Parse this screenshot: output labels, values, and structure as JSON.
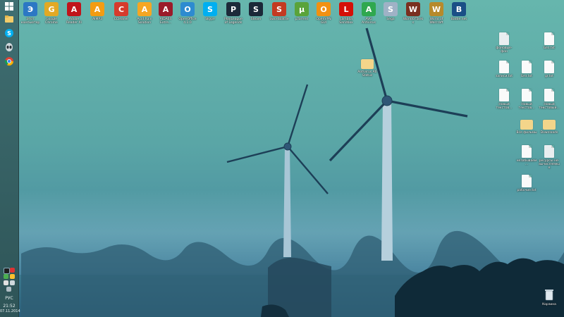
{
  "taskbar": {
    "pinned": [
      {
        "name": "start-button",
        "icon": "windows-logo-icon"
      },
      {
        "name": "explorer",
        "icon": "folder-icon"
      },
      {
        "name": "skype",
        "icon": "skype-icon"
      },
      {
        "name": "alienware",
        "icon": "alien-icon"
      },
      {
        "name": "chrome",
        "icon": "chrome-icon"
      }
    ],
    "language": "РУС",
    "time": "21:52",
    "date": "07.11.2014"
  },
  "desktop_top_row": [
    {
      "label": "Этот компьютер",
      "icon": "computer-icon",
      "color": "#2c78c4"
    },
    {
      "label": "Google Chrome",
      "icon": "chrome-icon",
      "color": "#e2a925"
    },
    {
      "label": "Adobe Reader XI",
      "icon": "acrobat-icon",
      "color": "#c0141b"
    },
    {
      "label": "AIMP3",
      "icon": "aimp-icon",
      "color": "#f39c12"
    },
    {
      "label": "CCleaner",
      "icon": "ccleaner-icon",
      "color": "#d63b2c"
    },
    {
      "label": "Acid Rain Solution",
      "icon": "star-icon",
      "color": "#f5a623"
    },
    {
      "label": "AIDA64 Extre...",
      "icon": "aida64-icon",
      "color": "#9b1b2a"
    },
    {
      "label": "OpenOffice 4.1.0",
      "icon": "openoffice-icon",
      "color": "#2d8bd0"
    },
    {
      "label": "Skype",
      "icon": "skype-icon",
      "color": "#00aff0"
    },
    {
      "label": "PlayLeague of Legends",
      "icon": "lol-icon",
      "color": "#1c2a3a"
    },
    {
      "label": "Steam",
      "icon": "steam-icon",
      "color": "#1b2838"
    },
    {
      "label": "SwordBattle",
      "icon": "game-icon",
      "color": "#c33a22"
    },
    {
      "label": "µTorrent",
      "icon": "utorrent-icon",
      "color": "#5aa33a"
    },
    {
      "label": "OpenVPN GUI",
      "icon": "openvpn-icon",
      "color": "#f29111"
    },
    {
      "label": "Lambda Sandbox",
      "icon": "lastfm-icon",
      "color": "#d51007"
    },
    {
      "label": "AVG Antivirus",
      "icon": "avg-icon",
      "color": "#2fa84f"
    },
    {
      "label": "Sega",
      "icon": "sega-icon",
      "color": "#9fb2c6"
    },
    {
      "label": "WorldOfTanks",
      "icon": "tanks-icon",
      "color": "#7a2f1f"
    },
    {
      "label": "World of Warcraft",
      "icon": "wow-icon",
      "color": "#b68a2c"
    },
    {
      "label": "Battle.net",
      "icon": "battlenet-icon",
      "color": "#1a4f86"
    }
  ],
  "desktop_mid": {
    "label": "Antivirus Ati Status",
    "icon": "folder-icon"
  },
  "desktop_right": [
    {
      "label": "фоновые-фон",
      "icon": "image-file-icon",
      "kind": "image"
    },
    {
      "label": "Без.txt",
      "icon": "text-file-icon",
      "kind": "file"
    },
    {
      "label": "записи.txt",
      "icon": "text-file-icon",
      "kind": "file"
    },
    {
      "label": "Без.txt",
      "icon": "text-file-icon",
      "kind": "file"
    },
    {
      "label": "gr.txt",
      "icon": "text-file-icon",
      "kind": "file"
    },
    {
      "label": "Новый текстов...",
      "icon": "text-file-icon",
      "kind": "file"
    },
    {
      "label": "Новый текстов...",
      "icon": "text-file-icon",
      "kind": "file"
    },
    {
      "label": "Новый текстовый...",
      "icon": "text-file-icon",
      "kind": "file"
    },
    {
      "label": "Все фильмы",
      "icon": "folder-icon",
      "kind": "folder"
    },
    {
      "label": "Downloads",
      "icon": "folder-icon",
      "kind": "folder"
    },
    {
      "label": "незабываем...",
      "icon": "document-icon",
      "kind": "doc"
    },
    {
      "label": "ресурсы-не-вычисляемые",
      "icon": "image-file-icon",
      "kind": "image"
    },
    {
      "label": "рабочие.txt",
      "icon": "text-file-icon",
      "kind": "file"
    }
  ],
  "recycle_bin": {
    "label": "Корзина",
    "icon": "recycle-bin-icon"
  }
}
